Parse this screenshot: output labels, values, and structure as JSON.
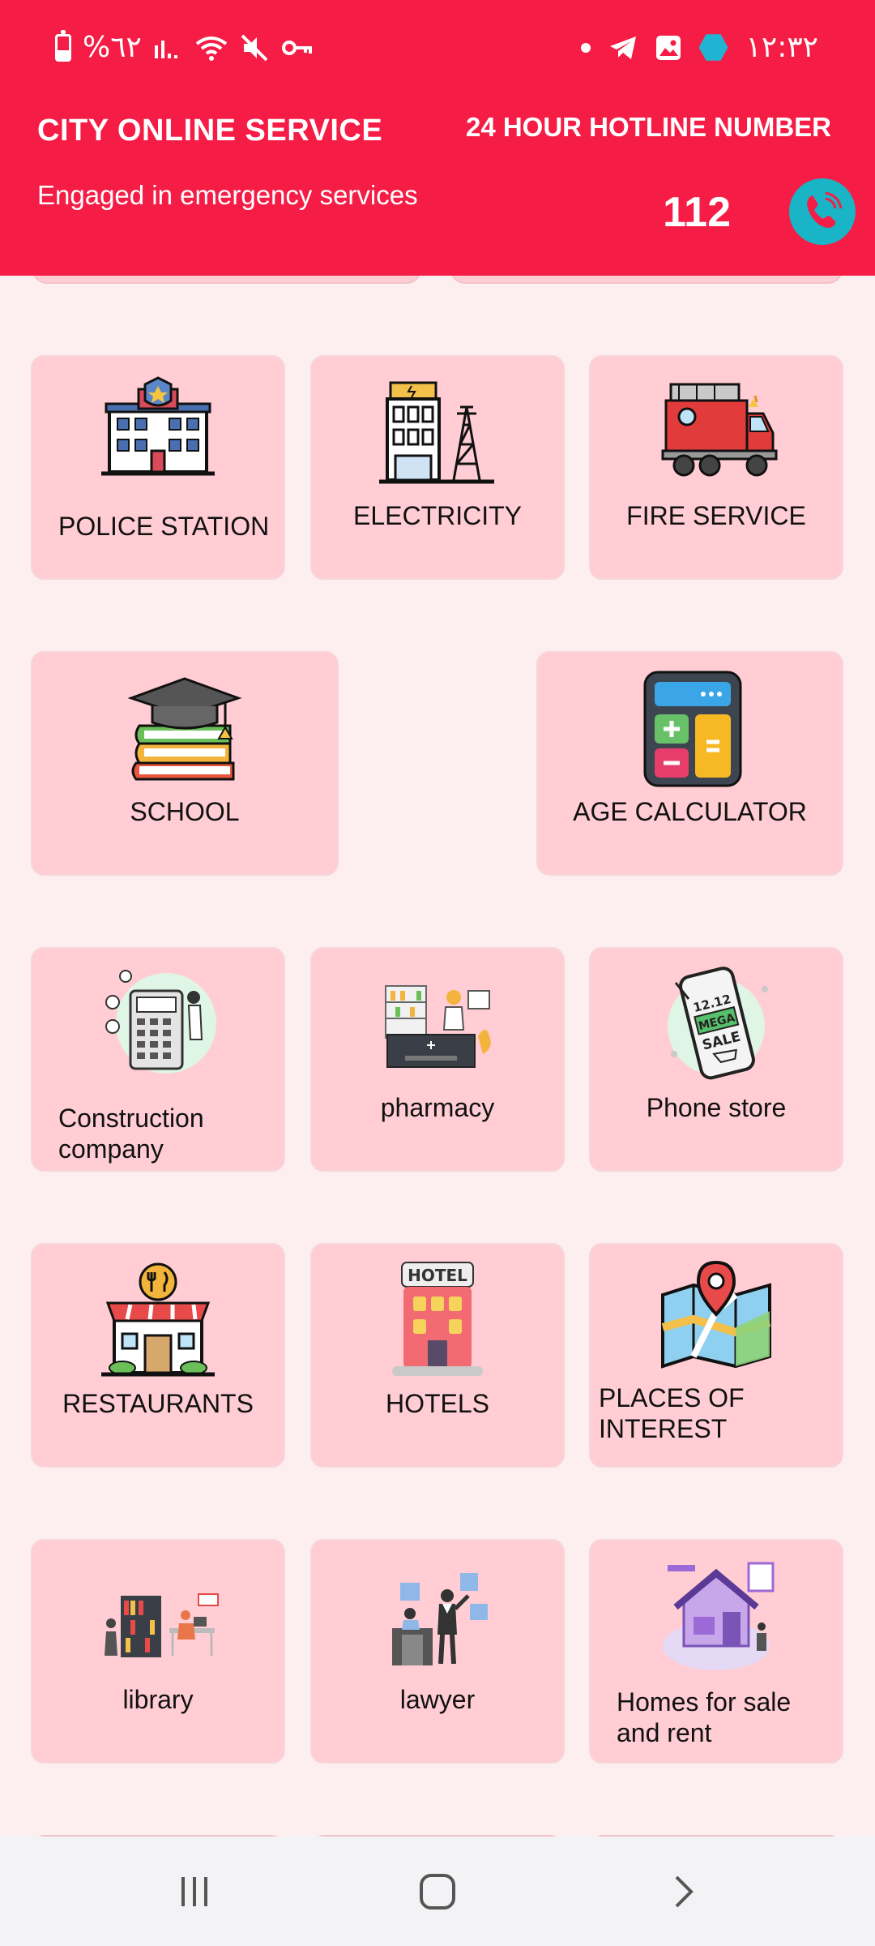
{
  "statusbar": {
    "battery_text": "%٦٢",
    "time": "١٢:٣٢"
  },
  "header": {
    "title": "CITY ONLINE SERVICE",
    "subtitle": "Engaged in emergency services",
    "hotline_label": "24 HOUR HOTLINE NUMBER",
    "hotline_number": "112"
  },
  "services": [
    {
      "label": "POLICE STATION",
      "icon": "police-station-icon"
    },
    {
      "label": "ELECTRICITY",
      "icon": "electricity-icon"
    },
    {
      "label": "FIRE SERVICE",
      "icon": "fire-truck-icon"
    },
    {
      "label": "SCHOOL",
      "icon": "school-books-icon"
    },
    {
      "label": "AGE CALCULATOR",
      "icon": "calculator-icon"
    },
    {
      "label": "Construction company",
      "icon": "construction-icon"
    },
    {
      "label": "pharmacy",
      "icon": "pharmacy-icon"
    },
    {
      "label": "Phone store",
      "icon": "phone-sale-icon"
    },
    {
      "label": "RESTAURANTS",
      "icon": "restaurant-icon"
    },
    {
      "label": "HOTELS",
      "icon": "hotel-icon"
    },
    {
      "label": "PLACES OF INTEREST",
      "icon": "map-pin-icon"
    },
    {
      "label": "library",
      "icon": "library-icon"
    },
    {
      "label": "lawyer",
      "icon": "lawyer-icon"
    },
    {
      "label": "Homes for sale and rent",
      "icon": "house-icon"
    }
  ],
  "colors": {
    "header": "#f51c46",
    "card": "#ffcdd3",
    "background": "#fdeff0",
    "call_button": "#19b4c5"
  }
}
